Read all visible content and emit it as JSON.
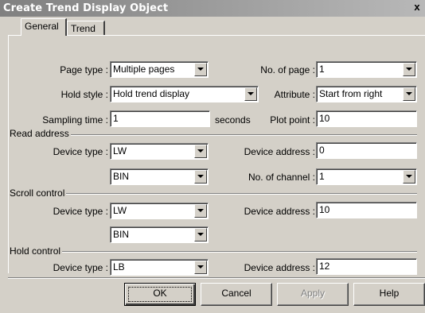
{
  "window": {
    "title": "Create Trend Display Object",
    "close_label": "x"
  },
  "tabs": [
    {
      "label": "General",
      "active": true
    },
    {
      "label": "Trend",
      "active": false
    }
  ],
  "general": {
    "page_type": {
      "label": "Page type :",
      "value": "Multiple pages"
    },
    "no_of_page": {
      "label": "No. of page :",
      "value": "1"
    },
    "hold_style": {
      "label": "Hold style :",
      "value": "Hold trend display"
    },
    "attribute": {
      "label": "Attribute :",
      "value": "Start from right"
    },
    "sampling_time": {
      "label": "Sampling time :",
      "value": "1",
      "unit": "seconds"
    },
    "plot_point": {
      "label": "Plot point :",
      "value": "10"
    }
  },
  "read_address": {
    "group_label": "Read address",
    "device_type": {
      "label": "Device type :",
      "value": "LW"
    },
    "device_address": {
      "label": "Device address :",
      "value": "0"
    },
    "format": {
      "value": "BIN"
    },
    "no_of_channel": {
      "label": "No. of channel :",
      "value": "1"
    }
  },
  "scroll_control": {
    "group_label": "Scroll control",
    "device_type": {
      "label": "Device type :",
      "value": "LW"
    },
    "device_address": {
      "label": "Device address :",
      "value": "10"
    },
    "format": {
      "value": "BIN"
    }
  },
  "hold_control": {
    "group_label": "Hold control",
    "device_type": {
      "label": "Device type :",
      "value": "LB"
    },
    "device_address": {
      "label": "Device address :",
      "value": "12"
    }
  },
  "buttons": {
    "ok": "OK",
    "cancel": "Cancel",
    "apply": "Apply",
    "help": "Help"
  },
  "colors": {
    "dialog_bg": "#d4d0c8",
    "titlebar_start": "#808080",
    "titlebar_end": "#b8b8b8",
    "disabled_text": "#808080"
  },
  "icons": {
    "combo_arrow": "chevron-down-icon",
    "close": "close-icon"
  }
}
